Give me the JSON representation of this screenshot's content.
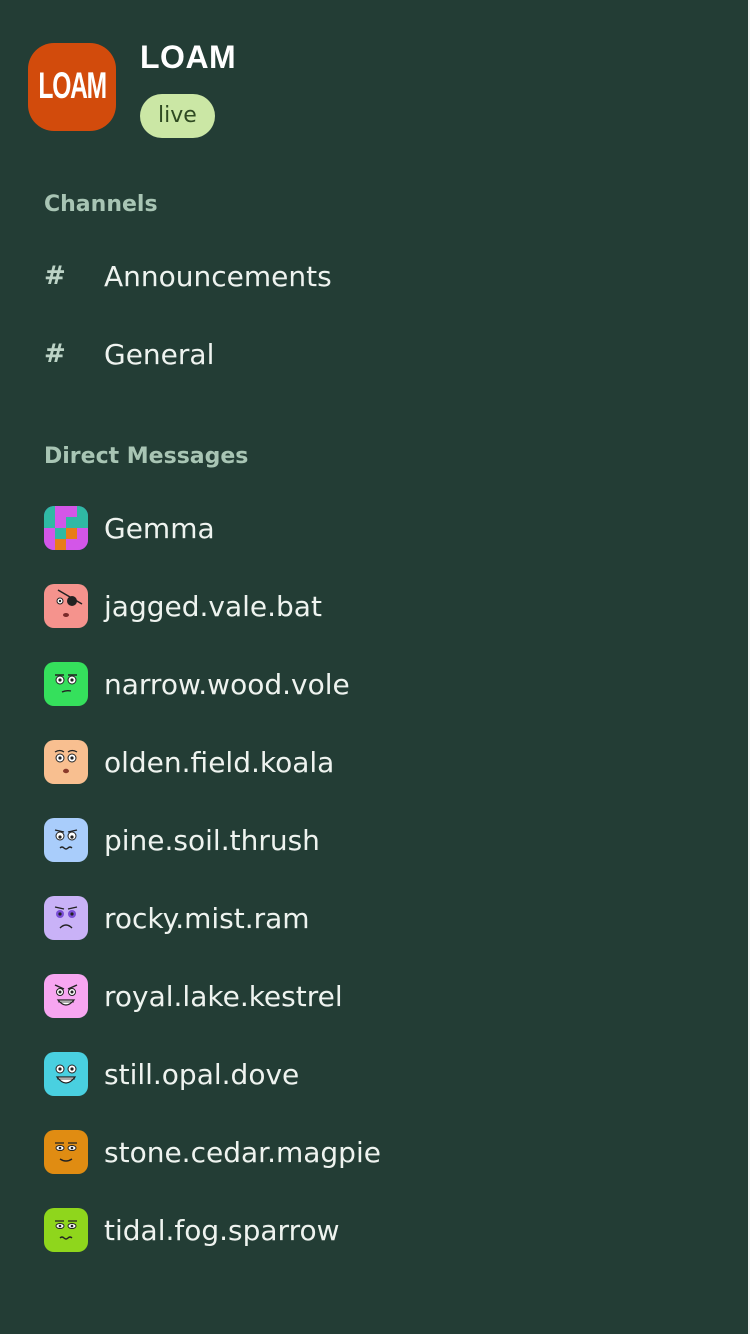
{
  "app": {
    "logo_text": "LOAM",
    "title": "LOAM",
    "status_badge": "live"
  },
  "channels": {
    "heading": "Channels",
    "items": [
      {
        "label": "Announcements"
      },
      {
        "label": "General"
      }
    ]
  },
  "direct_messages": {
    "heading": "Direct Messages",
    "items": [
      {
        "label": "Gemma",
        "avatar_color": "#6b4be0"
      },
      {
        "label": "jagged.vale.bat",
        "avatar_color": "#f5938d"
      },
      {
        "label": "narrow.wood.vole",
        "avatar_color": "#35e05c"
      },
      {
        "label": "olden.field.koala",
        "avatar_color": "#f8bf90"
      },
      {
        "label": "pine.soil.thrush",
        "avatar_color": "#a9cdfb"
      },
      {
        "label": "rocky.mist.ram",
        "avatar_color": "#c9b2f7"
      },
      {
        "label": "royal.lake.kestrel",
        "avatar_color": "#f7a6f1"
      },
      {
        "label": "still.opal.dove",
        "avatar_color": "#49d0e0"
      },
      {
        "label": "stone.cedar.magpie",
        "avatar_color": "#e08c12"
      },
      {
        "label": "tidal.fog.sparrow",
        "avatar_color": "#8fd61c"
      }
    ]
  },
  "colors": {
    "background": "#233d35",
    "logo": "#d24b0c",
    "badge": "#cbe7a5",
    "section_heading": "#a8c5b4"
  }
}
